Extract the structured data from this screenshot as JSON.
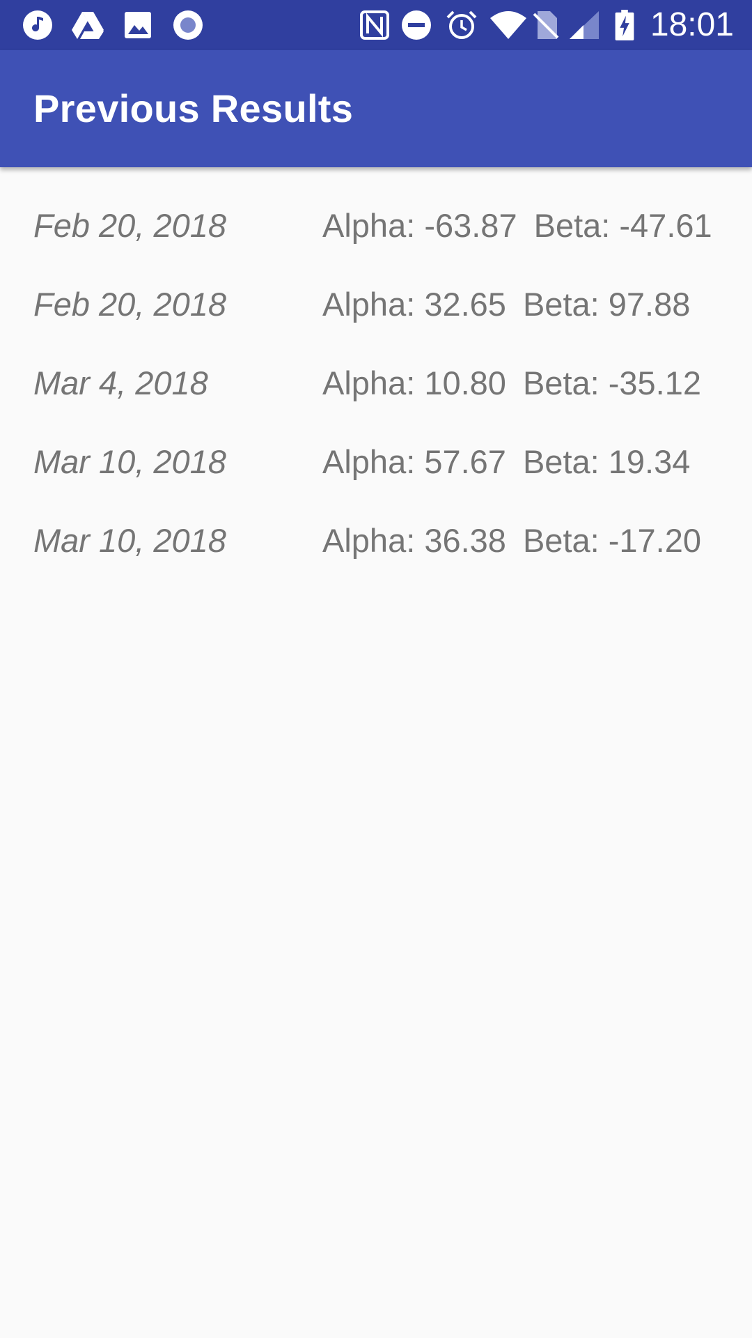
{
  "status_bar": {
    "time": "18:01",
    "icons": [
      "music-note-icon",
      "google-drive-icon",
      "image-icon",
      "record-icon",
      "nfc-icon",
      "do-not-disturb-icon",
      "alarm-icon",
      "wifi-icon",
      "no-sim-icon",
      "cell-signal-icon",
      "battery-charging-icon"
    ]
  },
  "app_bar": {
    "title": "Previous Results"
  },
  "results": [
    {
      "date": "Feb 20, 2018",
      "alpha": "Alpha: -63.87",
      "beta": "Beta: -47.61"
    },
    {
      "date": "Feb 20, 2018",
      "alpha": "Alpha: 32.65",
      "beta": "Beta: 97.88"
    },
    {
      "date": "Mar 4, 2018",
      "alpha": "Alpha: 10.80",
      "beta": "Beta: -35.12"
    },
    {
      "date": "Mar 10, 2018",
      "alpha": "Alpha: 57.67",
      "beta": "Beta: 19.34"
    },
    {
      "date": "Mar 10, 2018",
      "alpha": "Alpha: 36.38",
      "beta": "Beta: -17.20"
    }
  ],
  "colors": {
    "status_bar": "#303f9f",
    "app_bar": "#3f51b5",
    "background": "#fafafa",
    "row_text": "#757575"
  }
}
